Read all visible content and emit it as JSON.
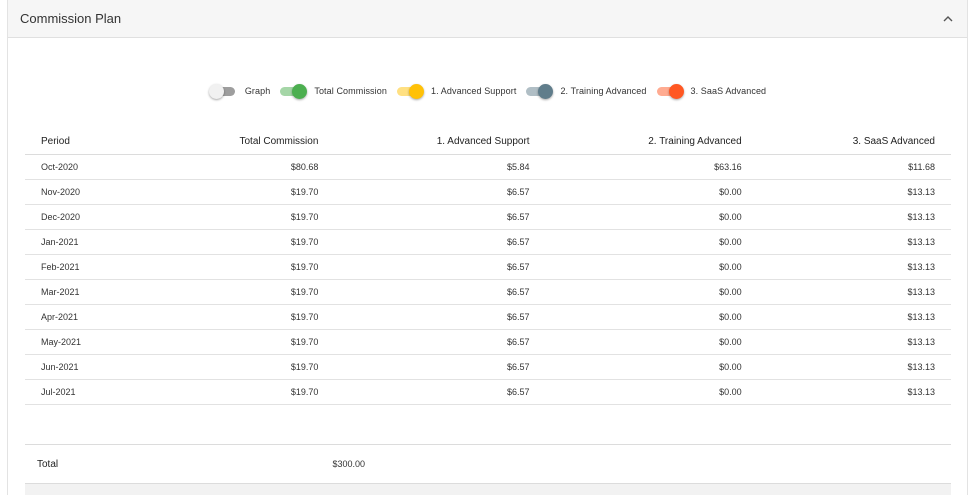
{
  "panel": {
    "title": "Commission Plan"
  },
  "legend": [
    {
      "label": "Graph",
      "on": false,
      "track": "#9e9e9e",
      "thumb": "#f1f1f1"
    },
    {
      "label": "Total Commission",
      "on": true,
      "track": "#a5d6a7",
      "thumb": "#4caf50"
    },
    {
      "label": "1. Advanced Support",
      "on": true,
      "track": "#ffe082",
      "thumb": "#ffc107"
    },
    {
      "label": "2. Training Advanced",
      "on": true,
      "track": "#b0bec5",
      "thumb": "#607d8b"
    },
    {
      "label": "3. SaaS Advanced",
      "on": true,
      "track": "#ffab91",
      "thumb": "#ff5722"
    }
  ],
  "table": {
    "columns": [
      "Period",
      "Total Commission",
      "1. Advanced Support",
      "2. Training Advanced",
      "3. SaaS Advanced"
    ],
    "rows": [
      [
        "Oct-2020",
        "$80.68",
        "$5.84",
        "$63.16",
        "$11.68"
      ],
      [
        "Nov-2020",
        "$19.70",
        "$6.57",
        "$0.00",
        "$13.13"
      ],
      [
        "Dec-2020",
        "$19.70",
        "$6.57",
        "$0.00",
        "$13.13"
      ],
      [
        "Jan-2021",
        "$19.70",
        "$6.57",
        "$0.00",
        "$13.13"
      ],
      [
        "Feb-2021",
        "$19.70",
        "$6.57",
        "$0.00",
        "$13.13"
      ],
      [
        "Mar-2021",
        "$19.70",
        "$6.57",
        "$0.00",
        "$13.13"
      ],
      [
        "Apr-2021",
        "$19.70",
        "$6.57",
        "$0.00",
        "$13.13"
      ],
      [
        "May-2021",
        "$19.70",
        "$6.57",
        "$0.00",
        "$13.13"
      ],
      [
        "Jun-2021",
        "$19.70",
        "$6.57",
        "$0.00",
        "$13.13"
      ],
      [
        "Jul-2021",
        "$19.70",
        "$6.57",
        "$0.00",
        "$13.13"
      ]
    ]
  },
  "total": {
    "label": "Total",
    "value": "$300.00"
  },
  "icons": {
    "collapse": "chevron-up-icon"
  }
}
